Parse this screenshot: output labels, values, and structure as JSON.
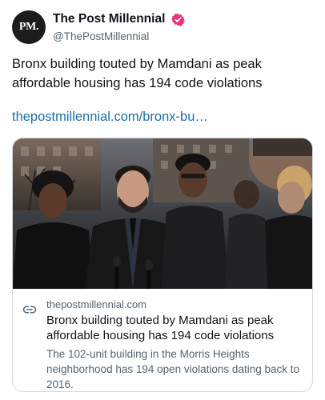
{
  "account": {
    "avatar_text": "PM.",
    "display_name": "The Post Millennial",
    "handle": "@ThePostMillennial",
    "verified_icon": "verified-badge-icon",
    "verified_color": "#e8327c"
  },
  "tweet": {
    "text": "Bronx building touted by Mamdani as peak affordable housing has 194 code violations",
    "link": "thepostmillennial.com/bronx-bu…",
    "link_color": "#1d6fa5"
  },
  "card": {
    "photo_icon": "press-conference-photo",
    "link_icon": "link-icon",
    "domain": "thepostmillennial.com",
    "title": "Bronx building touted by Mamdani as peak affordable housing has 194 code violations",
    "description": "The 102-unit building in the Morris Heights neighborhood has 194 open violations dating back to 2016."
  }
}
